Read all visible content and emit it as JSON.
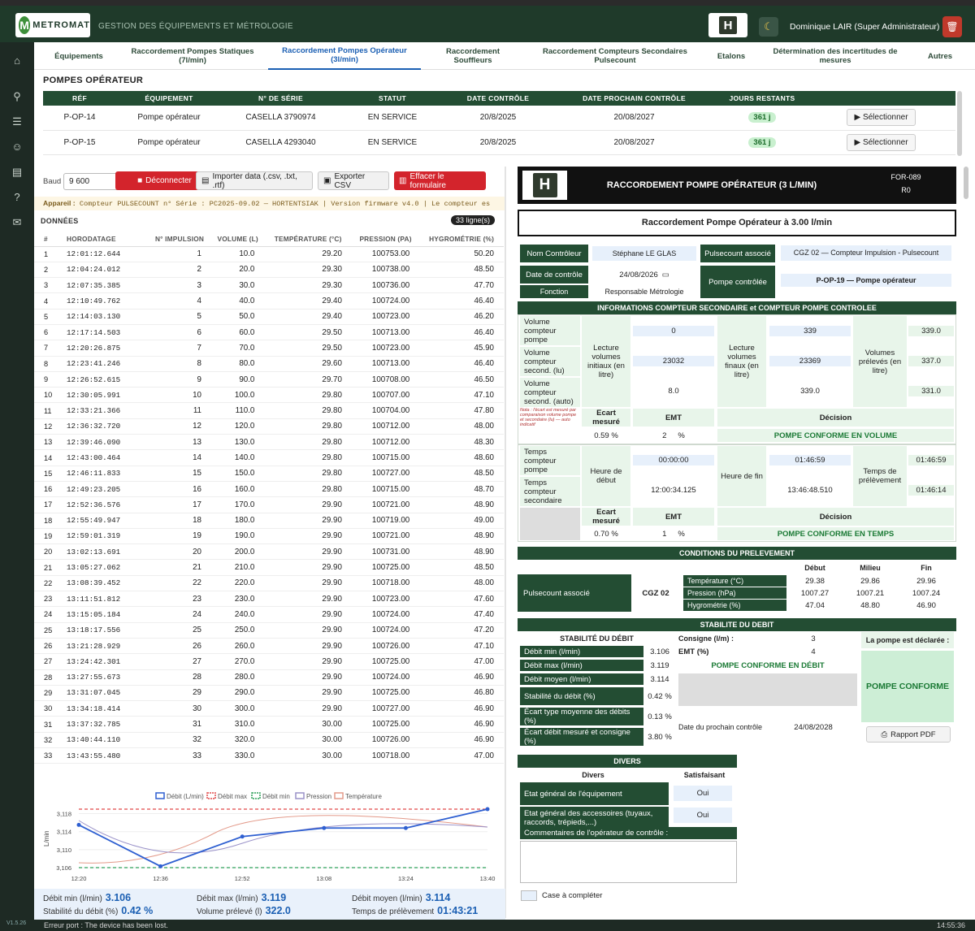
{
  "header": {
    "logo_text": "METROMAT",
    "logo_letter": "M",
    "app_title": "GESTION DES ÉQUIPEMENTS ET MÉTROLOGIE",
    "h_badge": "H",
    "user": "Dominique LAIR (Super Administrateur)"
  },
  "tabs": [
    "Équipements",
    "Raccordement Pompes Statiques (7l/min)",
    "Raccordement Pompes Opérateur (3l/min)",
    "Raccordement Souffleurs",
    "Raccordement Compteurs Secondaires Pulsecount",
    "Etalons",
    "Détermination des incertitudes de mesures",
    "Autres"
  ],
  "pumps": {
    "title": "POMPES OPÉRATEUR",
    "headers": [
      "RÉF",
      "ÉQUIPEMENT",
      "N° DE SÉRIE",
      "STATUT",
      "DATE CONTRÔLE",
      "DATE PROCHAIN CONTRÔLE",
      "JOURS RESTANTS",
      ""
    ],
    "rows": [
      [
        "P-OP-14",
        "Pompe opérateur",
        "CASELLA 3790974",
        "EN SERVICE",
        "20/8/2025",
        "20/08/2027",
        "361 j",
        "▶ Sélectionner"
      ],
      [
        "P-OP-15",
        "Pompe opérateur",
        "CASELLA 4293040",
        "EN SERVICE",
        "20/8/2025",
        "20/08/2027",
        "361 j",
        "▶ Sélectionner"
      ]
    ]
  },
  "toolbar": {
    "baud_label": "Baud",
    "baud_value": "9 600",
    "disconnect": "Déconnecter",
    "import": "Importer data (.csv, .txt, .rtf)",
    "export": "Exporter CSV",
    "clear": "Effacer le formulaire"
  },
  "appareil": {
    "label": "Appareil :",
    "text": "Compteur PULSECOUNT n° Série : PC2025-09.02 — HORTENTSIAK  |  Version firmware v4.0  |  Le compteur es"
  },
  "data_table": {
    "title": "DONNÉES",
    "count": "33 ligne(s)",
    "headers": [
      "#",
      "HORODATAGE",
      "N° IMPULSION",
      "VOLUME (L)",
      "TEMPÉRATURE (°C)",
      "PRESSION (PA)",
      "HYGROMÉTRIE (%)"
    ],
    "rows": [
      [
        "1",
        "12:01:12.644",
        "1",
        "10.0",
        "29.20",
        "100753.00",
        "50.20"
      ],
      [
        "2",
        "12:04:24.012",
        "2",
        "20.0",
        "29.30",
        "100738.00",
        "48.50"
      ],
      [
        "3",
        "12:07:35.385",
        "3",
        "30.0",
        "29.30",
        "100736.00",
        "47.70"
      ],
      [
        "4",
        "12:10:49.762",
        "4",
        "40.0",
        "29.40",
        "100724.00",
        "46.40"
      ],
      [
        "5",
        "12:14:03.130",
        "5",
        "50.0",
        "29.40",
        "100723.00",
        "46.20"
      ],
      [
        "6",
        "12:17:14.503",
        "6",
        "60.0",
        "29.50",
        "100713.00",
        "46.40"
      ],
      [
        "7",
        "12:20:26.875",
        "7",
        "70.0",
        "29.50",
        "100723.00",
        "45.90"
      ],
      [
        "8",
        "12:23:41.246",
        "8",
        "80.0",
        "29.60",
        "100713.00",
        "46.40"
      ],
      [
        "9",
        "12:26:52.615",
        "9",
        "90.0",
        "29.70",
        "100708.00",
        "46.50"
      ],
      [
        "10",
        "12:30:05.991",
        "10",
        "100.0",
        "29.80",
        "100707.00",
        "47.10"
      ],
      [
        "11",
        "12:33:21.366",
        "11",
        "110.0",
        "29.80",
        "100704.00",
        "47.80"
      ],
      [
        "12",
        "12:36:32.720",
        "12",
        "120.0",
        "29.80",
        "100712.00",
        "48.00"
      ],
      [
        "13",
        "12:39:46.090",
        "13",
        "130.0",
        "29.80",
        "100712.00",
        "48.30"
      ],
      [
        "14",
        "12:43:00.464",
        "14",
        "140.0",
        "29.80",
        "100715.00",
        "48.60"
      ],
      [
        "15",
        "12:46:11.833",
        "15",
        "150.0",
        "29.80",
        "100727.00",
        "48.50"
      ],
      [
        "16",
        "12:49:23.205",
        "16",
        "160.0",
        "29.80",
        "100715.00",
        "48.70"
      ],
      [
        "17",
        "12:52:36.576",
        "17",
        "170.0",
        "29.90",
        "100721.00",
        "48.90"
      ],
      [
        "18",
        "12:55:49.947",
        "18",
        "180.0",
        "29.90",
        "100719.00",
        "49.00"
      ],
      [
        "19",
        "12:59:01.319",
        "19",
        "190.0",
        "29.90",
        "100721.00",
        "48.90"
      ],
      [
        "20",
        "13:02:13.691",
        "20",
        "200.0",
        "29.90",
        "100731.00",
        "48.90"
      ],
      [
        "21",
        "13:05:27.062",
        "21",
        "210.0",
        "29.90",
        "100725.00",
        "48.50"
      ],
      [
        "22",
        "13:08:39.452",
        "22",
        "220.0",
        "29.90",
        "100718.00",
        "48.00"
      ],
      [
        "23",
        "13:11:51.812",
        "23",
        "230.0",
        "29.90",
        "100723.00",
        "47.60"
      ],
      [
        "24",
        "13:15:05.184",
        "24",
        "240.0",
        "29.90",
        "100724.00",
        "47.40"
      ],
      [
        "25",
        "13:18:17.556",
        "25",
        "250.0",
        "29.90",
        "100724.00",
        "47.20"
      ],
      [
        "26",
        "13:21:28.929",
        "26",
        "260.0",
        "29.90",
        "100726.00",
        "47.10"
      ],
      [
        "27",
        "13:24:42.301",
        "27",
        "270.0",
        "29.90",
        "100725.00",
        "47.00"
      ],
      [
        "28",
        "13:27:55.673",
        "28",
        "280.0",
        "29.90",
        "100724.00",
        "46.90"
      ],
      [
        "29",
        "13:31:07.045",
        "29",
        "290.0",
        "29.90",
        "100725.00",
        "46.80"
      ],
      [
        "30",
        "13:34:18.414",
        "30",
        "300.0",
        "29.90",
        "100727.00",
        "46.90"
      ],
      [
        "31",
        "13:37:32.785",
        "31",
        "310.0",
        "30.00",
        "100725.00",
        "46.90"
      ],
      [
        "32",
        "13:40:44.110",
        "32",
        "320.0",
        "30.00",
        "100726.00",
        "46.90"
      ],
      [
        "33",
        "13:43:55.480",
        "33",
        "330.0",
        "30.00",
        "100718.00",
        "47.00"
      ]
    ]
  },
  "chart_data": {
    "type": "line",
    "x_ticks": [
      "12:20",
      "12:36",
      "12:52",
      "13:08",
      "13:24",
      "13:40"
    ],
    "ylabel": "L/min",
    "y_ticks": [
      "3,106",
      "3,110",
      "3,114",
      "3,118"
    ],
    "ylim": [
      3.106,
      3.119
    ],
    "legend": [
      "Débit (L/min)",
      "Débit max",
      "Débit min",
      "Pression",
      "Température"
    ],
    "series": [
      {
        "name": "Débit (L/min)",
        "color": "#2e5fd1",
        "x": [
          0,
          0.2,
          0.4,
          0.6,
          0.8,
          1.0
        ],
        "values": [
          3.1155,
          3.1063,
          3.1129,
          3.1148,
          3.1148,
          3.119
        ]
      },
      {
        "name": "Débit max",
        "color": "#e04848",
        "value": 3.119
      },
      {
        "name": "Débit min",
        "color": "#2fa05a",
        "value": 3.106
      }
    ]
  },
  "summary": {
    "debit_min_label": "Débit min (l/min)",
    "debit_min": "3.106",
    "debit_max_label": "Débit max (l/min)",
    "debit_max": "3.119",
    "debit_moyen_label": "Débit moyen (l/min)",
    "debit_moyen": "3.114",
    "stab_label": "Stabilité du débit (%)",
    "stab": "0.42 %",
    "vol_label": "Volume prélevé (l)",
    "vol": "322.0",
    "temps_label": "Temps de prélèvement",
    "temps": "01:43:21"
  },
  "status": {
    "error": "Erreur port : The device has been lost.",
    "clock": "14:55:36",
    "version": "V1.5.26"
  },
  "form": {
    "title": "RACCORDEMENT POMPE OPÉRATEUR (3 L/MIN)",
    "code": "FOR-089",
    "rev": "R0",
    "subtitle": "Raccordement Pompe Opérateur à 3.00 l/min",
    "nom_label": "Nom Contrôleur",
    "nom": "Stéphane LE GLAS",
    "pulse_label": "Pulsecount associé",
    "pulse": "CGZ 02 — Compteur Impulsion - Pulsecount",
    "date_label": "Date de contrôle",
    "date": "24/08/2026",
    "fonction_label": "Fonction",
    "fonction": "Responsable Métrologie",
    "pompe_label": "Pompe contrôlée",
    "pompe": "P-OP-19 — Pompe opérateur",
    "info_title": "INFORMATIONS COMPTEUR SECONDAIRE et COMPTEUR POMPE CONTROLEE",
    "vc_pompe": "Volume compteur pompe",
    "vc_lu": "Volume compteur second. (lu)",
    "vc_auto": "Volume compteur second. (auto)",
    "lect_init": "Lecture volumes initiaux (en litre)",
    "lect_fin": "Lecture volumes finaux (en litre)",
    "vol_prel": "Volumes prélevés (en litre)",
    "vi": [
      "0",
      "23032",
      "8.0"
    ],
    "vf": [
      "339",
      "23369",
      "339.0"
    ],
    "vp": [
      "339.0",
      "337.0",
      "331.0"
    ],
    "note": "Nota : l'écart est mesuré par comparaison volume pompe et secondaire (lu) — auto indicatif",
    "ecart_label": "Ecart mesuré",
    "emt_label": "EMT",
    "decision_label": "Décision",
    "ecart_vol": "0.59 %",
    "emt_vol": "2",
    "pct": "%",
    "decision_vol": "POMPE CONFORME EN VOLUME",
    "t_pompe": "Temps compteur pompe",
    "t_sec": "Temps compteur secondaire",
    "heure_debut": "Heure de début",
    "heure_fin": "Heure de fin",
    "temps_prel": "Temps de prélèvement",
    "hd": [
      "00:00:00",
      "12:00:34.125"
    ],
    "hf": [
      "01:46:59",
      "13:46:48.510"
    ],
    "tp": [
      "01:46:59",
      "01:46:14"
    ],
    "ecart_t": "0.70 %",
    "emt_t": "1",
    "decision_t": "POMPE CONFORME EN TEMPS",
    "cond_title": "CONDITIONS DU PRELEVEMENT",
    "cond_pulse_label": "Pulsecount associé",
    "cond_pulse": "CGZ 02",
    "debut": "Début",
    "milieu": "Milieu",
    "fin": "Fin",
    "temp_label": "Température (°C)",
    "press_label": "Pression (hPa)",
    "hygro_label": "Hygrométrie (%)",
    "temp": [
      "29.38",
      "29.86",
      "29.96"
    ],
    "press": [
      "1007.27",
      "1007.21",
      "1007.24"
    ],
    "hygro": [
      "47.04",
      "48.80",
      "46.90"
    ],
    "stab_title": "STABILITE DU DEBIT",
    "stab_sub": "STABILITÉ DU DÉBIT",
    "consigne_label": "Consigne (l/m) :",
    "consigne": "3",
    "emt_pct_label": "EMT (%)",
    "emt_pct": "4",
    "declaree": "La pompe est déclarée :",
    "verdict": "POMPE CONFORME",
    "conforme_debit": "POMPE CONFORME EN DÉBIT",
    "dmin_l": "Débit min (l/min)",
    "dmin": "3.106",
    "dmax_l": "Débit max (l/min)",
    "dmax": "3.119",
    "dmoy_l": "Débit moyen (l/min)",
    "dmoy": "3.114",
    "stab_l": "Stabilité du débit (%)",
    "stab": "0.42 %",
    "ecty_l": "Écart type moyenne des débits (%)",
    "ecty": "0.13 %",
    "ecc_l": "Écart débit mesuré et consigne (%)",
    "ecc": "3.80 %",
    "prochain_label": "Date du prochain contrôle",
    "prochain": "24/08/2028",
    "rapport": "Rapport PDF",
    "divers_title": "DIVERS",
    "divers": "Divers",
    "satisf": "Satisfaisant",
    "etat_eq": "Etat général de l'équipement",
    "etat_acc": "Etat général des accessoires (tuyaux, raccords, trépieds,...)",
    "oui": "Oui",
    "comment_label": "Commentaires de l'opérateur de contrôle :",
    "case": "Case à compléter"
  }
}
